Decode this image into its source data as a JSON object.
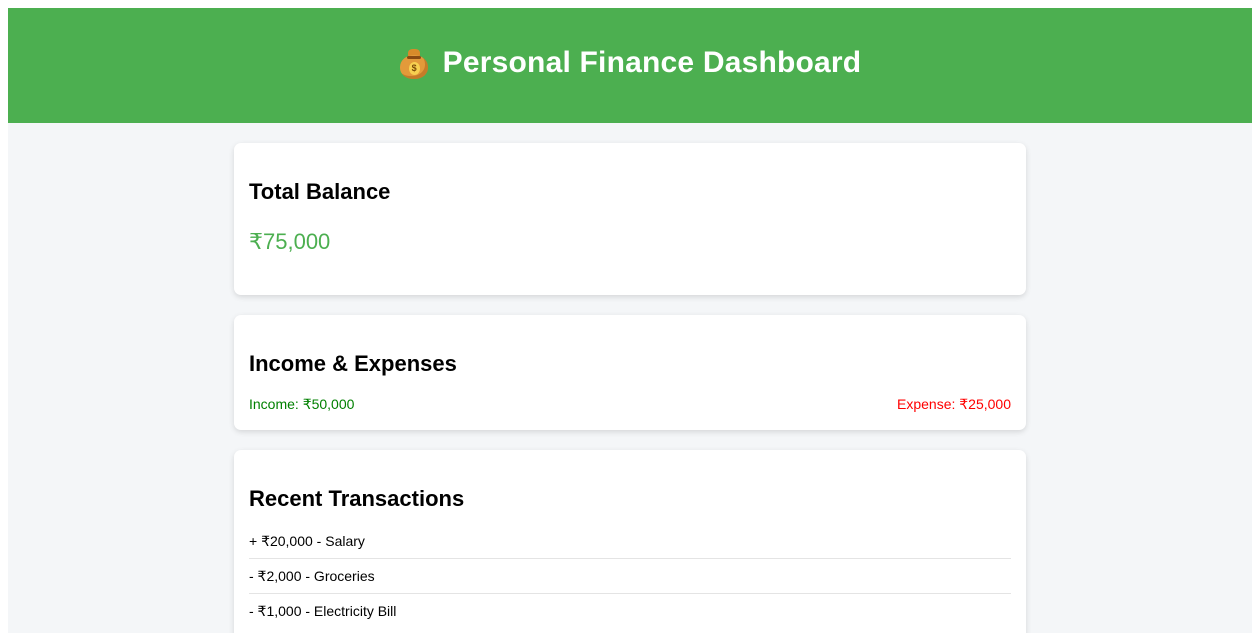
{
  "header": {
    "title": "Personal Finance Dashboard",
    "icon": "money-bag-icon",
    "background": "#4caf50"
  },
  "balance": {
    "heading": "Total Balance",
    "amount": "₹75,000",
    "color": "#4caf50"
  },
  "income_expenses": {
    "heading": "Income & Expenses",
    "income": "Income: ₹50,000",
    "expense": "Expense: ₹25,000",
    "income_color": "#008000",
    "expense_color": "#ff0000"
  },
  "transactions": {
    "heading": "Recent Transactions",
    "items": [
      "+ ₹20,000 - Salary",
      "- ₹2,000 - Groceries",
      "- ₹1,000 - Electricity Bill"
    ]
  }
}
